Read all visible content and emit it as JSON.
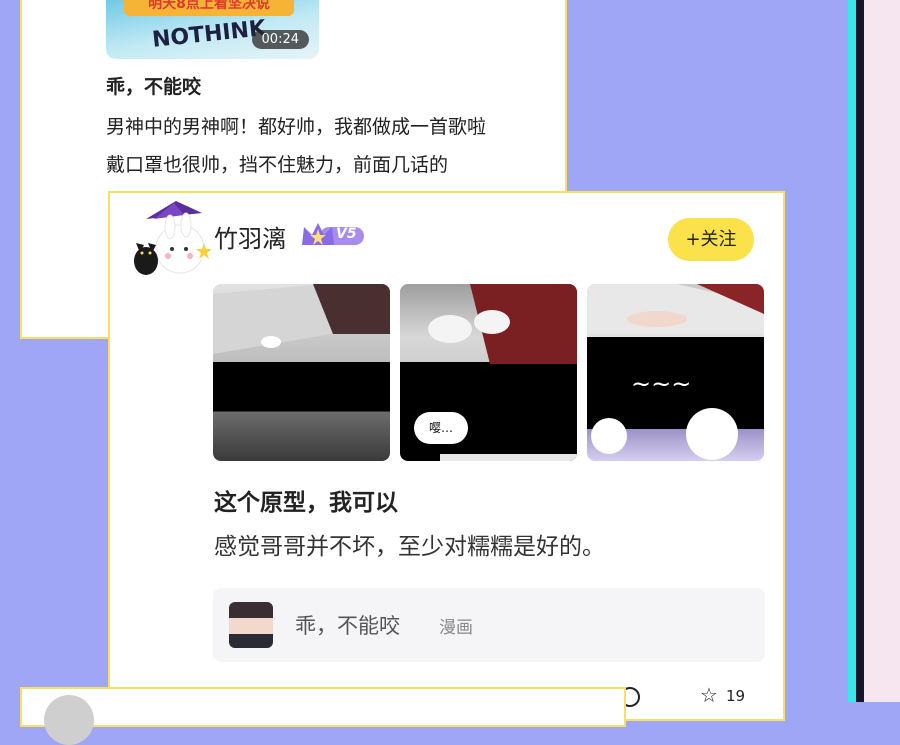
{
  "back_post": {
    "video_banner": "明天8点上看坚决说",
    "video_overlay_text": "NOTHINK",
    "duration": "00:24",
    "title": "乖，不能咬",
    "lines": [
      "男神中的男神啊！都好帅，我都做成一首歌啦",
      "戴口罩也很帅，挡不住魅力，前面几话的"
    ]
  },
  "front_post": {
    "username": "竹羽漓",
    "vip_level": "V5",
    "follow_label": "+关注",
    "bubble_text": "嘤…",
    "title": "这个原型，我可以",
    "body": "感觉哥哥并不坏，至少对糯糯是好的。",
    "comic": {
      "title": "乖，不能咬",
      "tag": "漫画"
    },
    "like_count": "19"
  },
  "colors": {
    "background": "#9fa6f6",
    "card_border": "#f6df62",
    "follow_button": "#fbe14a",
    "accent_stripe": "#39e6e8"
  }
}
